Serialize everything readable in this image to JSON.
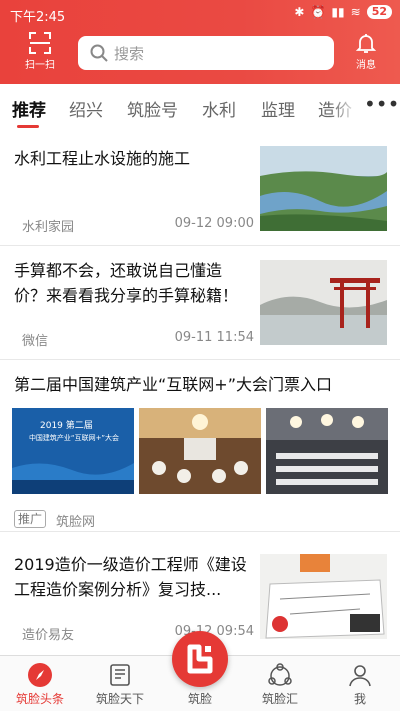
{
  "status": {
    "time": "下午2:45",
    "battery": "52"
  },
  "header": {
    "scan_label": "扫一扫",
    "search_placeholder": "搜索",
    "message_label": "消息"
  },
  "tabs": [
    {
      "label": "推荐"
    },
    {
      "label": "绍兴"
    },
    {
      "label": "筑脸号"
    },
    {
      "label": "水利"
    },
    {
      "label": "监理"
    },
    {
      "label": "造价"
    }
  ],
  "feed": [
    {
      "title": "水利工程止水设施的施工",
      "source": "水利家园",
      "date": "09-12 09:00",
      "image": "river-landscape"
    },
    {
      "title": "手算都不会，还敢说自己懂造价？来看看我分享的手算秘籍！",
      "source": "微信",
      "date": "09-11 11:54",
      "image": "torii-gate-lake"
    },
    {
      "title": "第二届中国建筑产业“互联网+”大会门票入口",
      "badge": "推广",
      "source": "筑脸网",
      "poster_title": "2019 第二届",
      "poster_subtitle": "中国建筑产业“互联网+”大会",
      "images": [
        "conference-poster",
        "banquet-hall",
        "conference-hall"
      ]
    },
    {
      "title": "2019造价一级造价工程师《建设工程造价案例分析》复习技...",
      "source": "造价易友",
      "date": "09-12 09:54",
      "image": "drafting-desk"
    }
  ],
  "bottom_nav": [
    {
      "label": "筑脸头条",
      "icon": "compass-icon"
    },
    {
      "label": "筑脸天下",
      "icon": "news-icon"
    },
    {
      "label": "筑脸",
      "icon": "logo-icon"
    },
    {
      "label": "筑脸汇",
      "icon": "network-icon"
    },
    {
      "label": "我",
      "icon": "user-icon"
    }
  ],
  "colors": {
    "brand": "#e9423c",
    "active": "#e53935"
  }
}
